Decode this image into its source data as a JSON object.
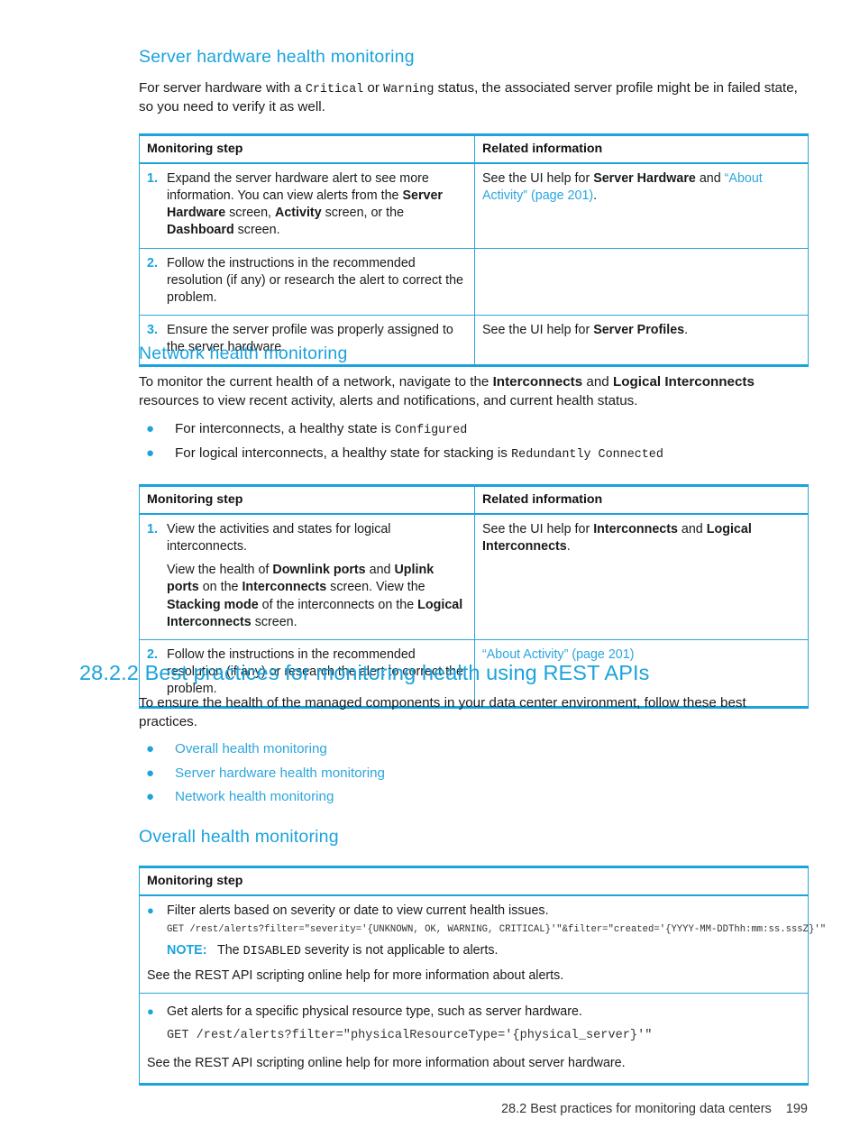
{
  "page": {
    "footer_title": "28.2 Best practices for monitoring data centers",
    "page_number": "199"
  },
  "colors": {
    "heading_blue": "#1ba3dd",
    "link_blue": "#2ca6de",
    "table_border": "#1ba3dd",
    "text": "#1a1a1a"
  },
  "sections": {
    "server_hardware": {
      "heading": "Server hardware health monitoring",
      "intro_1": "For server hardware with a ",
      "intro_code_1": "Critical",
      "intro_2": " or ",
      "intro_code_2": "Warning",
      "intro_3": " status, the associated server profile might be in failed state, so you need to verify it as well.",
      "table": {
        "headers": [
          "Monitoring step",
          "Related information"
        ],
        "rows": [
          {
            "num": "1.",
            "step_parts": [
              {
                "t": "Expand the server hardware alert to see more information. You can view alerts from the ",
                "s": "n"
              },
              {
                "t": "Server Hardware",
                "s": "b"
              },
              {
                "t": " screen, ",
                "s": "n"
              },
              {
                "t": "Activity",
                "s": "b"
              },
              {
                "t": " screen, or the ",
                "s": "n"
              },
              {
                "t": "Dashboard",
                "s": "b"
              },
              {
                "t": " screen.",
                "s": "n"
              }
            ],
            "related_parts": [
              {
                "t": "See the UI help for ",
                "s": "n"
              },
              {
                "t": "Server Hardware",
                "s": "b"
              },
              {
                "t": " and ",
                "s": "n"
              },
              {
                "t": "“About Activity” (page 201)",
                "s": "l"
              },
              {
                "t": ".",
                "s": "n"
              }
            ]
          },
          {
            "num": "2.",
            "step_parts": [
              {
                "t": "Follow the instructions in the recommended resolution (if any) or research the alert to correct the problem.",
                "s": "n"
              }
            ],
            "related_parts": []
          },
          {
            "num": "3.",
            "step_parts": [
              {
                "t": "Ensure the server profile was properly assigned to the server hardware.",
                "s": "n"
              }
            ],
            "related_parts": [
              {
                "t": "See the UI help for ",
                "s": "n"
              },
              {
                "t": "Server Profiles",
                "s": "b"
              },
              {
                "t": ".",
                "s": "n"
              }
            ]
          }
        ]
      }
    },
    "network": {
      "heading": "Network health monitoring",
      "intro_parts": [
        {
          "t": "To monitor the current health of a network, navigate to the ",
          "s": "n"
        },
        {
          "t": "Interconnects",
          "s": "b"
        },
        {
          "t": " and ",
          "s": "n"
        },
        {
          "t": "Logical Interconnects",
          "s": "b"
        },
        {
          "t": " resources to view recent activity, alerts and notifications, and current health status.",
          "s": "n"
        }
      ],
      "bullets": [
        [
          {
            "t": "For interconnects, a healthy state is ",
            "s": "n"
          },
          {
            "t": "Configured",
            "s": "c"
          }
        ],
        [
          {
            "t": "For logical interconnects, a healthy state for stacking is ",
            "s": "n"
          },
          {
            "t": "Redundantly Connected",
            "s": "c"
          }
        ]
      ],
      "table": {
        "headers": [
          "Monitoring step",
          "Related information"
        ],
        "rows": [
          {
            "num": "1.",
            "step_paragraphs": [
              [
                {
                  "t": "View the activities and states for logical interconnects.",
                  "s": "n"
                }
              ],
              [
                {
                  "t": "View the health of ",
                  "s": "n"
                },
                {
                  "t": "Downlink ports",
                  "s": "b"
                },
                {
                  "t": " and ",
                  "s": "n"
                },
                {
                  "t": "Uplink ports",
                  "s": "b"
                },
                {
                  "t": " on the ",
                  "s": "n"
                },
                {
                  "t": "Interconnects",
                  "s": "b"
                },
                {
                  "t": " screen. View the ",
                  "s": "n"
                },
                {
                  "t": "Stacking mode",
                  "s": "b"
                },
                {
                  "t": " of the interconnects on the ",
                  "s": "n"
                },
                {
                  "t": "Logical Interconnects",
                  "s": "b"
                },
                {
                  "t": " screen.",
                  "s": "n"
                }
              ]
            ],
            "related_parts": [
              {
                "t": "See the UI help for ",
                "s": "n"
              },
              {
                "t": "Interconnects",
                "s": "b"
              },
              {
                "t": " and ",
                "s": "n"
              },
              {
                "t": "Logical Interconnects",
                "s": "b"
              },
              {
                "t": ".",
                "s": "n"
              }
            ]
          },
          {
            "num": "2.",
            "step_paragraphs": [
              [
                {
                  "t": "Follow the instructions in the recommended resolution (if any) or research the alert to correct the problem.",
                  "s": "n"
                }
              ]
            ],
            "related_parts": [
              {
                "t": "“About Activity” (page 201)",
                "s": "l"
              }
            ]
          }
        ]
      }
    },
    "rest_apis": {
      "heading": "28.2.2 Best practices for monitoring health using REST APIs",
      "intro": "To ensure the health of the managed components in your data center environment, follow these best practices.",
      "links": [
        "Overall health monitoring",
        "Server hardware health monitoring",
        "Network health monitoring"
      ]
    },
    "overall": {
      "heading": "Overall health monitoring",
      "table": {
        "headers": [
          "Monitoring step"
        ],
        "rows": [
          {
            "bullet_text": "Filter alerts based on severity or date to view current health issues.",
            "code": "GET /rest/alerts?filter=\"severity='{UNKNOWN, OK, WARNING, CRITICAL}'\"&filter=\"created='{YYYY-MM-DDThh:mm:ss.sssZ}'\"",
            "code_size": "small",
            "note_label": "NOTE:",
            "note_parts": [
              {
                "t": "The ",
                "s": "n"
              },
              {
                "t": "DISABLED",
                "s": "c"
              },
              {
                "t": " severity is not applicable to alerts.",
                "s": "n"
              }
            ],
            "after": "See the REST API scripting online help for more information about alerts."
          },
          {
            "bullet_text": "Get alerts for a specific physical resource type, such as server hardware.",
            "code": "GET /rest/alerts?filter=\"physicalResourceType='{physical_server}'\"",
            "code_size": "big",
            "note_label": "",
            "note_parts": [],
            "after": "See the REST API scripting online help for more information about server hardware."
          }
        ]
      }
    }
  }
}
